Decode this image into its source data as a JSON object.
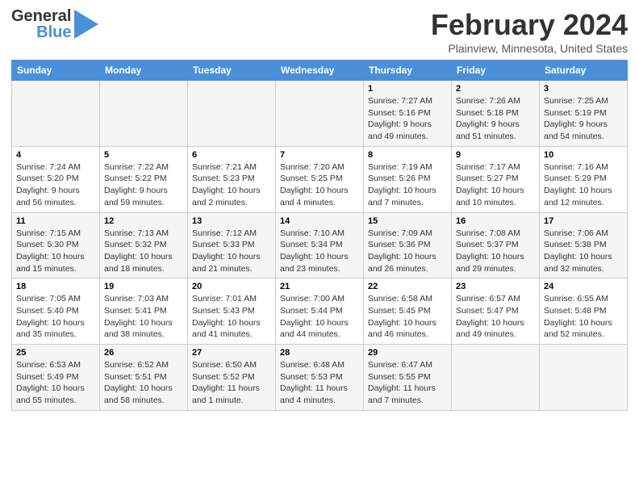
{
  "logo": {
    "line1": "General",
    "line2": "Blue"
  },
  "title": "February 2024",
  "subtitle": "Plainview, Minnesota, United States",
  "days_header": [
    "Sunday",
    "Monday",
    "Tuesday",
    "Wednesday",
    "Thursday",
    "Friday",
    "Saturday"
  ],
  "weeks": [
    [
      {
        "day": "",
        "info": ""
      },
      {
        "day": "",
        "info": ""
      },
      {
        "day": "",
        "info": ""
      },
      {
        "day": "",
        "info": ""
      },
      {
        "day": "1",
        "info": "Sunrise: 7:27 AM\nSunset: 5:16 PM\nDaylight: 9 hours\nand 49 minutes."
      },
      {
        "day": "2",
        "info": "Sunrise: 7:26 AM\nSunset: 5:18 PM\nDaylight: 9 hours\nand 51 minutes."
      },
      {
        "day": "3",
        "info": "Sunrise: 7:25 AM\nSunset: 5:19 PM\nDaylight: 9 hours\nand 54 minutes."
      }
    ],
    [
      {
        "day": "4",
        "info": "Sunrise: 7:24 AM\nSunset: 5:20 PM\nDaylight: 9 hours\nand 56 minutes."
      },
      {
        "day": "5",
        "info": "Sunrise: 7:22 AM\nSunset: 5:22 PM\nDaylight: 9 hours\nand 59 minutes."
      },
      {
        "day": "6",
        "info": "Sunrise: 7:21 AM\nSunset: 5:23 PM\nDaylight: 10 hours\nand 2 minutes."
      },
      {
        "day": "7",
        "info": "Sunrise: 7:20 AM\nSunset: 5:25 PM\nDaylight: 10 hours\nand 4 minutes."
      },
      {
        "day": "8",
        "info": "Sunrise: 7:19 AM\nSunset: 5:26 PM\nDaylight: 10 hours\nand 7 minutes."
      },
      {
        "day": "9",
        "info": "Sunrise: 7:17 AM\nSunset: 5:27 PM\nDaylight: 10 hours\nand 10 minutes."
      },
      {
        "day": "10",
        "info": "Sunrise: 7:16 AM\nSunset: 5:29 PM\nDaylight: 10 hours\nand 12 minutes."
      }
    ],
    [
      {
        "day": "11",
        "info": "Sunrise: 7:15 AM\nSunset: 5:30 PM\nDaylight: 10 hours\nand 15 minutes."
      },
      {
        "day": "12",
        "info": "Sunrise: 7:13 AM\nSunset: 5:32 PM\nDaylight: 10 hours\nand 18 minutes."
      },
      {
        "day": "13",
        "info": "Sunrise: 7:12 AM\nSunset: 5:33 PM\nDaylight: 10 hours\nand 21 minutes."
      },
      {
        "day": "14",
        "info": "Sunrise: 7:10 AM\nSunset: 5:34 PM\nDaylight: 10 hours\nand 23 minutes."
      },
      {
        "day": "15",
        "info": "Sunrise: 7:09 AM\nSunset: 5:36 PM\nDaylight: 10 hours\nand 26 minutes."
      },
      {
        "day": "16",
        "info": "Sunrise: 7:08 AM\nSunset: 5:37 PM\nDaylight: 10 hours\nand 29 minutes."
      },
      {
        "day": "17",
        "info": "Sunrise: 7:06 AM\nSunset: 5:38 PM\nDaylight: 10 hours\nand 32 minutes."
      }
    ],
    [
      {
        "day": "18",
        "info": "Sunrise: 7:05 AM\nSunset: 5:40 PM\nDaylight: 10 hours\nand 35 minutes."
      },
      {
        "day": "19",
        "info": "Sunrise: 7:03 AM\nSunset: 5:41 PM\nDaylight: 10 hours\nand 38 minutes."
      },
      {
        "day": "20",
        "info": "Sunrise: 7:01 AM\nSunset: 5:43 PM\nDaylight: 10 hours\nand 41 minutes."
      },
      {
        "day": "21",
        "info": "Sunrise: 7:00 AM\nSunset: 5:44 PM\nDaylight: 10 hours\nand 44 minutes."
      },
      {
        "day": "22",
        "info": "Sunrise: 6:58 AM\nSunset: 5:45 PM\nDaylight: 10 hours\nand 46 minutes."
      },
      {
        "day": "23",
        "info": "Sunrise: 6:57 AM\nSunset: 5:47 PM\nDaylight: 10 hours\nand 49 minutes."
      },
      {
        "day": "24",
        "info": "Sunrise: 6:55 AM\nSunset: 5:48 PM\nDaylight: 10 hours\nand 52 minutes."
      }
    ],
    [
      {
        "day": "25",
        "info": "Sunrise: 6:53 AM\nSunset: 5:49 PM\nDaylight: 10 hours\nand 55 minutes."
      },
      {
        "day": "26",
        "info": "Sunrise: 6:52 AM\nSunset: 5:51 PM\nDaylight: 10 hours\nand 58 minutes."
      },
      {
        "day": "27",
        "info": "Sunrise: 6:50 AM\nSunset: 5:52 PM\nDaylight: 11 hours\nand 1 minute."
      },
      {
        "day": "28",
        "info": "Sunrise: 6:48 AM\nSunset: 5:53 PM\nDaylight: 11 hours\nand 4 minutes."
      },
      {
        "day": "29",
        "info": "Sunrise: 6:47 AM\nSunset: 5:55 PM\nDaylight: 11 hours\nand 7 minutes."
      },
      {
        "day": "",
        "info": ""
      },
      {
        "day": "",
        "info": ""
      }
    ]
  ]
}
